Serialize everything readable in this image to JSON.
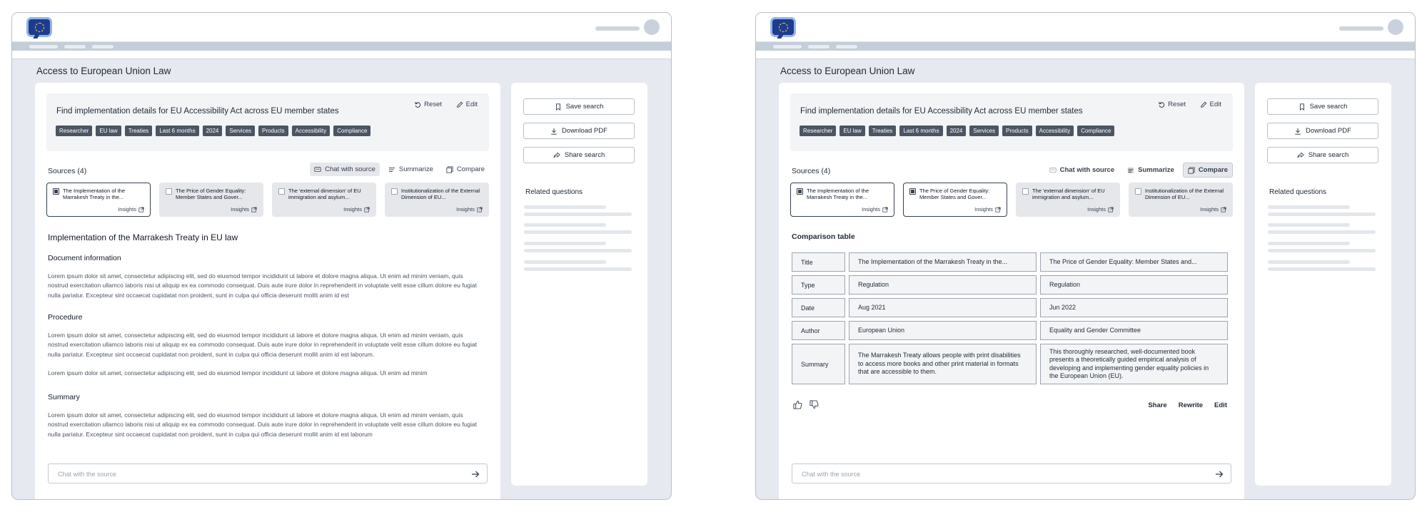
{
  "page": {
    "title": "Access to European Union Law"
  },
  "query": {
    "text": "Find implementation details for EU Accessibility Act across EU member states",
    "reset_label": "Reset",
    "edit_label": "Edit",
    "tags": [
      "Researcher",
      "EU law",
      "Treaties",
      "Last 6 months",
      "2024",
      "Services",
      "Products",
      "Accessibility",
      "Compliance"
    ]
  },
  "sources": {
    "heading": "Sources (4)",
    "actions": {
      "chat": "Chat with source",
      "summarize": "Summarize",
      "compare": "Compare"
    },
    "insights_label": "Insights",
    "items": [
      {
        "title": "The Implementation of the Marrakesh Treaty in the..."
      },
      {
        "title": "The Price of Gender Equality: Member States and Gover..."
      },
      {
        "title": "The 'external dimension' of EU immigration and asylum..."
      },
      {
        "title": "Institutionalization of the External Dimension of EU..."
      }
    ]
  },
  "left_panel": {
    "selected_sources": [
      0
    ],
    "doc_title": "Implementation of the Marrakesh Treaty in EU law",
    "sections": [
      {
        "heading": "Document information",
        "body": "Lorem ipsum dolor sit amet, consectetur adipiscing elit, sed do eiusmod tempor incididunt ut labore et dolore magna aliqua. Ut enim ad minim veniam, quis nostrud exercitation ullamco laboris nisi ut aliquip ex ea commodo consequat. Duis aute irure dolor in reprehenderit in voluptate velit esse cillum dolore eu fugiat nulla pariatur. Excepteur sint occaecat cupidatat non proident, sunt in culpa qui officia deserunt mollit anim id est"
      },
      {
        "heading": "Procedure",
        "body": "Lorem ipsum dolor sit amet, consectetur adipiscing elit, sed do eiusmod tempor incididunt ut labore et dolore magna aliqua. Ut enim ad minim veniam, quis nostrud exercitation ullamco laboris nisi ut aliquip ex ea commodo consequat. Duis aute irure dolor in reprehenderit in voluptate velit esse cillum dolore eu fugiat nulla pariatur. Excepteur sint occaecat cupidatat non proident, sunt in culpa qui officia deserunt mollit anim id est laborum.",
        "body2": "Lorem ipsum dolor sit amet, consectetur adipiscing elit, sed do eiusmod tempor incididunt ut labore et dolore magna aliqua. Ut enim ad minim"
      },
      {
        "heading": "Summary",
        "body": "Lorem ipsum dolor sit amet, consectetur adipiscing elit, sed do eiusmod tempor incididunt ut labore et dolore magna aliqua. Ut enim ad minim veniam, quis nostrud exercitation ullamco laboris nisi ut aliquip ex ea commodo consequat. Duis aute irure dolor in reprehenderit in voluptate velit esse cillum dolore eu fugiat nulla pariatur. Excepteur sint occaecat cupidatat non proident, sunt in culpa qui officia deserunt mollit anim id est laborum"
      }
    ]
  },
  "right_panel": {
    "selected_sources": [
      0,
      1
    ],
    "comparison_title": "Comparison table",
    "rows": [
      {
        "label": "Title",
        "a": "The Implementation of the Marrakesh Treaty in the...",
        "b": "The Price of Gender Equality: Member States and..."
      },
      {
        "label": "Type",
        "a": "Regulation",
        "b": "Regulation"
      },
      {
        "label": "Date",
        "a": "Aug 2021",
        "b": "Jun 2022"
      },
      {
        "label": "Author",
        "a": "European Union",
        "b": "Equality and Gender Committee"
      },
      {
        "label": "Summary",
        "a": "The Marrakesh Treaty allows people with print disabilities to access more books and other print material in formats that are accessible to them.",
        "b": "This thoroughly researched, well-documented book presents a theoretically guided empirical analysis of developing and implementing gender equality policies in the European Union (EU)."
      }
    ],
    "actions": {
      "share": "Share",
      "rewrite": "Rewrite",
      "edit": "Edit"
    }
  },
  "chat": {
    "placeholder": "Chat with the source"
  },
  "sidebar": {
    "save_search": "Save search",
    "download_pdf": "Download PDF",
    "share_search": "Share search",
    "related_heading": "Related questions"
  },
  "colors": {
    "tag_bg": "#4b5563",
    "frame_bg": "#e6e9ef",
    "nav_bar": "#c3ced9",
    "brand_blue": "#1d3c8f"
  }
}
